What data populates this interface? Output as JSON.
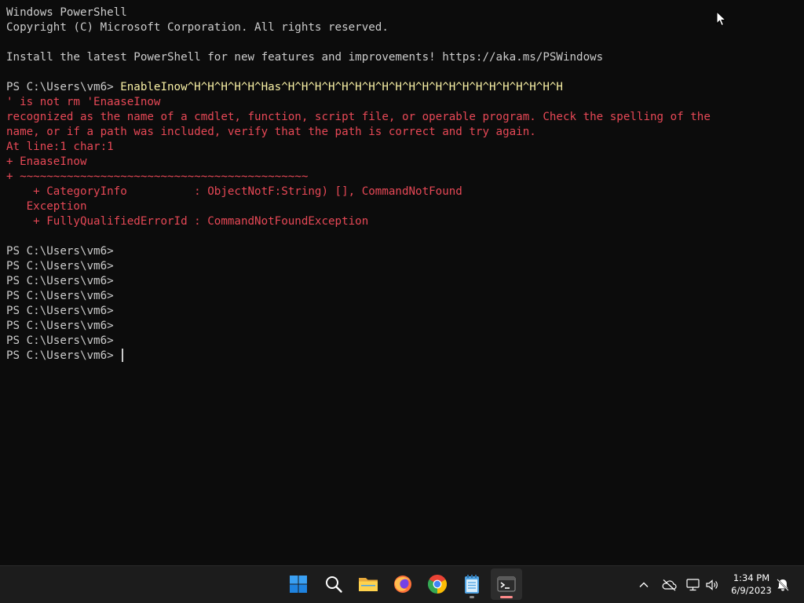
{
  "terminal": {
    "lines": [
      {
        "text": "Windows PowerShell"
      },
      {
        "text": "Copyright (C) Microsoft Corporation. All rights reserved."
      },
      {
        "text": ""
      },
      {
        "text": "Install the latest PowerShell for new features and improvements! https://aka.ms/PSWindows"
      },
      {
        "text": ""
      },
      {
        "prompt": "PS C:\\Users\\vm6> ",
        "command": "EnableInow^H^H^H^H^H^Has^H^H^H^H^H^H^H^H^H^H^H^H^H^H^H^H^H^H^H^H^H"
      },
      {
        "text": "' is not rm 'EnaaseInow",
        "style": "err"
      },
      {
        "text": "recognized as the name of a cmdlet, function, script file, or operable program. Check the spelling of the",
        "style": "err"
      },
      {
        "text": "name, or if a path was included, verify that the path is correct and try again.",
        "style": "err"
      },
      {
        "text": "At line:1 char:1",
        "style": "err"
      },
      {
        "text": "+ EnaaseInow",
        "style": "err"
      },
      {
        "text": "+ ~~~~~~~~~~~~~~~~~~~~~~~~~~~~~~~~~~~~~~~~~~~",
        "style": "err"
      },
      {
        "text": "    + CategoryInfo          : ObjectNotF:String) [], CommandNotFound",
        "style": "err"
      },
      {
        "text": "   Exception",
        "style": "err"
      },
      {
        "text": "    + FullyQualifiedErrorId : CommandNotFoundException",
        "style": "err"
      },
      {
        "text": ""
      },
      {
        "text": "PS C:\\Users\\vm6>"
      },
      {
        "text": "PS C:\\Users\\vm6>"
      },
      {
        "text": "PS C:\\Users\\vm6>"
      },
      {
        "text": "PS C:\\Users\\vm6>"
      },
      {
        "text": "PS C:\\Users\\vm6>"
      },
      {
        "text": "PS C:\\Users\\vm6>"
      },
      {
        "text": "PS C:\\Users\\vm6>"
      },
      {
        "prompt": "PS C:\\Users\\vm6> ",
        "command": "",
        "cursor": true
      }
    ]
  },
  "taskbar": {
    "apps": [
      {
        "name": "start-button",
        "icon": "windows-icon"
      },
      {
        "name": "search-button",
        "icon": "search-icon"
      },
      {
        "name": "file-explorer-button",
        "icon": "folder-icon"
      },
      {
        "name": "firefox-button",
        "icon": "firefox-icon"
      },
      {
        "name": "chrome-button",
        "icon": "chrome-icon"
      },
      {
        "name": "notepad-button",
        "icon": "notepad-icon",
        "running": true
      },
      {
        "name": "terminal-button",
        "icon": "terminal-icon",
        "running": true,
        "active": true
      }
    ],
    "tray": {
      "icons": [
        "chevron-up-icon",
        "onedrive-offline-icon",
        "network-icon",
        "volume-icon"
      ],
      "time": "1:34 PM",
      "date": "6/9/2023",
      "notification_icon": "notification-icon"
    }
  },
  "colors": {
    "background": "#0c0c0c",
    "text": "#cccccc",
    "error": "#e74856",
    "command": "#f9f1a5",
    "taskbar": "#1c1c1c"
  }
}
